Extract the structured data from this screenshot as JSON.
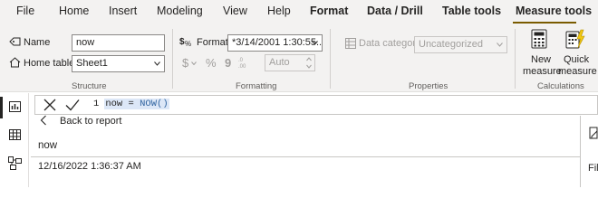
{
  "menu": {
    "file": "File",
    "home": "Home",
    "insert": "Insert",
    "modeling": "Modeling",
    "view": "View",
    "help": "Help",
    "format": "Format",
    "data_drill": "Data / Drill",
    "table_tools": "Table tools",
    "measure_tools": "Measure tools"
  },
  "structure": {
    "name_label": "Name",
    "name_value": "now",
    "home_table_label": "Home table",
    "home_table_value": "Sheet1",
    "group_label": "Structure"
  },
  "formatting": {
    "format_label": "Format",
    "format_value": "*3/14/2001 1:30:55...",
    "currency_symbol": "$",
    "percent_symbol": "%",
    "comma_symbol": "9",
    "decimals_value": "Auto",
    "group_label": "Formatting"
  },
  "properties": {
    "data_category_label": "Data category",
    "data_category_value": "Uncategorized",
    "group_label": "Properties"
  },
  "calculations": {
    "new_measure_line1": "New",
    "new_measure_line2": "measure",
    "quick_measure_line1": "Quick",
    "quick_measure_line2": "measure",
    "group_label": "Calculations"
  },
  "formula": {
    "line_number": "1",
    "text_plain": "now = ",
    "text_function": "NOW()"
  },
  "content": {
    "back_label": "Back to report",
    "column_header": "now",
    "cell_value": "12/16/2022 1:36:37 AM"
  },
  "right_panel": {
    "partial_text": "Fil"
  },
  "colors": {
    "accent_underline": "#7a5b00",
    "ribbon_bg": "#f3f2f1",
    "function_blue": "#3165a1"
  }
}
